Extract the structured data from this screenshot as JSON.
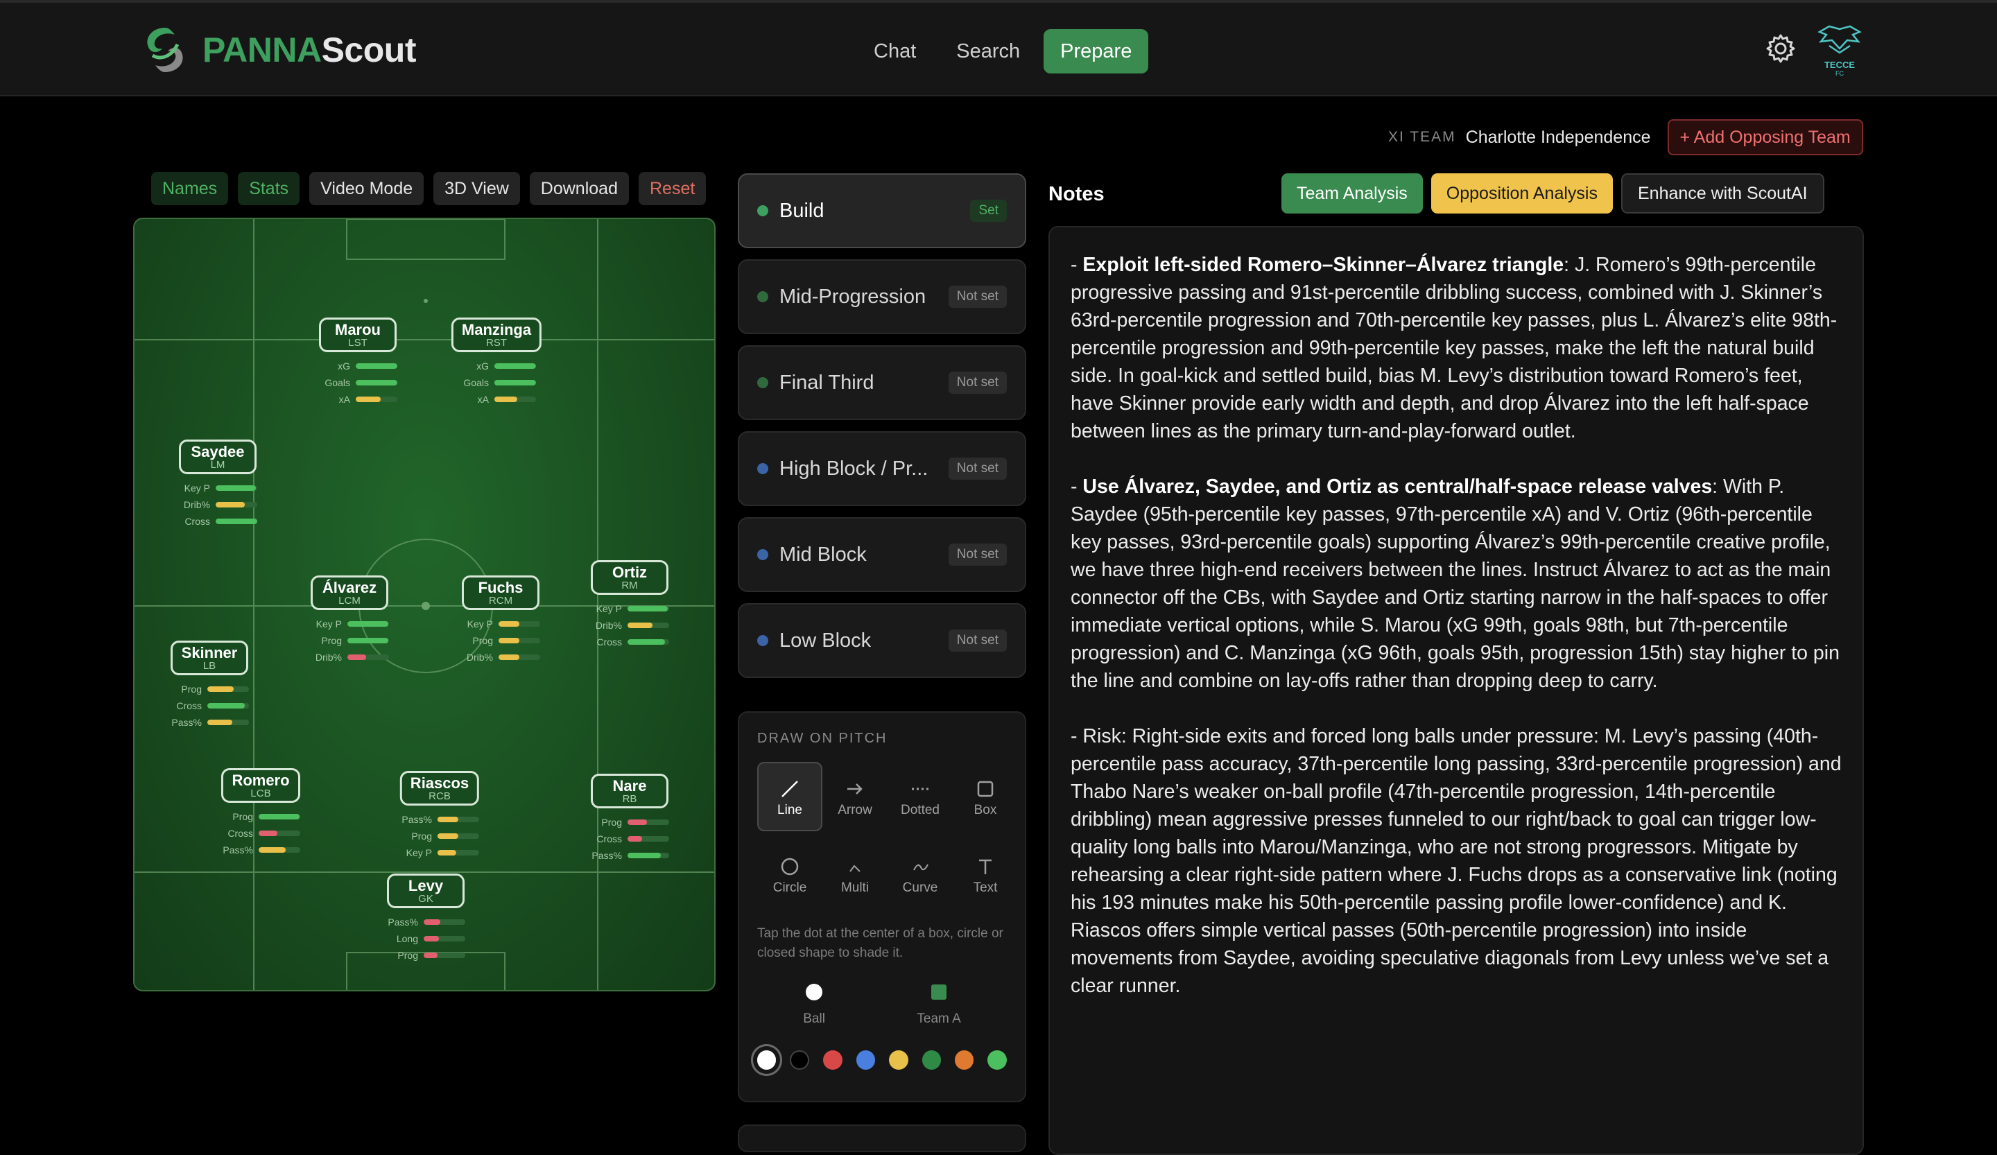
{
  "brand": {
    "prefix": "PANNA",
    "suffix": "Scout"
  },
  "nav": {
    "items": [
      "Chat",
      "Search",
      "Prepare"
    ],
    "active": "Prepare"
  },
  "header": {
    "settings_icon": "gear-icon",
    "crest_text": "TECCE FC"
  },
  "xi": {
    "label": "XI TEAM",
    "team": "Charlotte Independence",
    "add_button": "+ Add Opposing Team"
  },
  "toolbar": {
    "names": "Names",
    "stats": "Stats",
    "video": "Video Mode",
    "view3d": "3D View",
    "download": "Download",
    "reset": "Reset"
  },
  "players": [
    {
      "name": "Marou",
      "role": "LST",
      "stats": [
        {
          "label": "xG",
          "v": 1.0,
          "c": "#4cc05e"
        },
        {
          "label": "Goals",
          "v": 1.0,
          "c": "#4cc05e"
        },
        {
          "label": "xA",
          "v": 0.6,
          "c": "#e8c04a"
        }
      ]
    },
    {
      "name": "Manzinga",
      "role": "RST",
      "stats": [
        {
          "label": "xG",
          "v": 1.0,
          "c": "#4cc05e"
        },
        {
          "label": "Goals",
          "v": 1.0,
          "c": "#4cc05e"
        },
        {
          "label": "xA",
          "v": 0.55,
          "c": "#e8c04a"
        }
      ]
    },
    {
      "name": "Saydee",
      "role": "LM",
      "stats": [
        {
          "label": "Key P",
          "v": 0.97,
          "c": "#4cc05e"
        },
        {
          "label": "Drib%",
          "v": 0.7,
          "c": "#e8c04a"
        },
        {
          "label": "Cross",
          "v": 1.0,
          "c": "#4cc05e"
        }
      ]
    },
    {
      "name": "Álvarez",
      "role": "LCM",
      "stats": [
        {
          "label": "Key P",
          "v": 0.99,
          "c": "#4cc05e"
        },
        {
          "label": "Prog",
          "v": 0.98,
          "c": "#4cc05e"
        },
        {
          "label": "Drib%",
          "v": 0.45,
          "c": "#e06070"
        }
      ]
    },
    {
      "name": "Fuchs",
      "role": "RCM",
      "stats": [
        {
          "label": "Key P",
          "v": 0.5,
          "c": "#e8c04a"
        },
        {
          "label": "Prog",
          "v": 0.5,
          "c": "#e8c04a"
        },
        {
          "label": "Drib%",
          "v": 0.5,
          "c": "#e8c04a"
        }
      ]
    },
    {
      "name": "Ortiz",
      "role": "RM",
      "stats": [
        {
          "label": "Key P",
          "v": 0.96,
          "c": "#4cc05e"
        },
        {
          "label": "Drib%",
          "v": 0.6,
          "c": "#e8c04a"
        },
        {
          "label": "Cross",
          "v": 0.9,
          "c": "#4cc05e"
        }
      ]
    },
    {
      "name": "Skinner",
      "role": "LB",
      "stats": [
        {
          "label": "Prog",
          "v": 0.63,
          "c": "#e8c04a"
        },
        {
          "label": "Cross",
          "v": 0.9,
          "c": "#4cc05e"
        },
        {
          "label": "Pass%",
          "v": 0.6,
          "c": "#e8c04a"
        }
      ]
    },
    {
      "name": "Romero",
      "role": "LCB",
      "stats": [
        {
          "label": "Prog",
          "v": 0.99,
          "c": "#4cc05e"
        },
        {
          "label": "Cross",
          "v": 0.45,
          "c": "#e06070"
        },
        {
          "label": "Pass%",
          "v": 0.65,
          "c": "#e8c04a"
        }
      ]
    },
    {
      "name": "Riascos",
      "role": "RCB",
      "stats": [
        {
          "label": "Pass%",
          "v": 0.5,
          "c": "#e8c04a"
        },
        {
          "label": "Prog",
          "v": 0.5,
          "c": "#e8c04a"
        },
        {
          "label": "Key P",
          "v": 0.45,
          "c": "#e8c04a"
        }
      ]
    },
    {
      "name": "Nare",
      "role": "RB",
      "stats": [
        {
          "label": "Prog",
          "v": 0.47,
          "c": "#e06070"
        },
        {
          "label": "Cross",
          "v": 0.35,
          "c": "#e06070"
        },
        {
          "label": "Pass%",
          "v": 0.8,
          "c": "#4cc05e"
        }
      ]
    },
    {
      "name": "Levy",
      "role": "GK",
      "stats": [
        {
          "label": "Pass%",
          "v": 0.4,
          "c": "#e06070"
        },
        {
          "label": "Long",
          "v": 0.37,
          "c": "#e06070"
        },
        {
          "label": "Prog",
          "v": 0.33,
          "c": "#e06070"
        }
      ]
    }
  ],
  "phases": [
    {
      "title": "Build",
      "status": "Set",
      "dot": "#3ea05e"
    },
    {
      "title": "Mid-Progression",
      "status": "Not set",
      "dot": "#2f6a3c"
    },
    {
      "title": "Final Third",
      "status": "Not set",
      "dot": "#2f6a3c"
    },
    {
      "title": "High Block / Pr...",
      "status": "Not set",
      "dot": "#3a64a6"
    },
    {
      "title": "Mid Block",
      "status": "Not set",
      "dot": "#3a64a6"
    },
    {
      "title": "Low Block",
      "status": "Not set",
      "dot": "#3a64a6"
    }
  ],
  "draw": {
    "heading": "DRAW ON PITCH",
    "tools": [
      {
        "label": "Line",
        "icon": "line-icon"
      },
      {
        "label": "Arrow",
        "icon": "arrow-icon"
      },
      {
        "label": "Dotted",
        "icon": "dotted-icon"
      },
      {
        "label": "Box",
        "icon": "box-icon"
      },
      {
        "label": "Circle",
        "icon": "circle-icon"
      },
      {
        "label": "Multi",
        "icon": "multi-icon"
      },
      {
        "label": "Curve",
        "icon": "curve-icon"
      },
      {
        "label": "Text",
        "icon": "text-icon"
      }
    ],
    "hint": "Tap the dot at the center of a box, circle or closed shape to shade it.",
    "ball": "Ball",
    "team": "Team A",
    "colors": [
      "#ffffff",
      "#000000",
      "#d94848",
      "#4a7fe0",
      "#e8c04a",
      "#2f8a46",
      "#e07a30",
      "#4cc05e"
    ]
  },
  "notes": {
    "heading": "Notes",
    "buttons": {
      "team": "Team Analysis",
      "opp": "Opposition Analysis",
      "enhance": "Enhance with ScoutAI"
    },
    "p1_bold": "Exploit left-sided Romero–Skinner–Álvarez triangle",
    "p1": ": J. Romero’s 99th-percentile progressive passing and 91st-percentile dribbling success, combined with J. Skinner’s 63rd-percentile progression and 70th-percentile key passes, plus L. Álvarez’s elite 98th-percentile progression and 99th-percentile key passes, make the left the natural build side. In goal-kick and settled build, bias M. Levy’s distribution toward Romero’s feet, have Skinner provide early width and depth, and drop Álvarez into the left half-space between lines as the primary turn-and-play-forward outlet.",
    "p2_bold": "Use Álvarez, Saydee, and Ortiz as central/half-space release valves",
    "p2": ": With P. Saydee (95th-percentile key passes, 97th-percentile xA) and V. Ortiz (96th-percentile key passes, 93rd-percentile goals) supporting Álvarez’s 99th-percentile creative profile, we have three high-end receivers between the lines. Instruct Álvarez to act as the main connector off the CBs, with Saydee and Ortiz starting narrow in the half-spaces to offer immediate vertical options, while S. Marou (xG 99th, goals 98th, but 7th-percentile progression) and C. Manzinga (xG 96th, goals 95th, progression 15th) stay higher to pin the line and combine on lay-offs rather than dropping deep to carry.",
    "p3": "- Risk: Right-side exits and forced long balls under pressure: M. Levy’s passing (40th-percentile pass accuracy, 37th-percentile long passing, 33rd-percentile progression) and Thabo Nare’s weaker on-ball profile (47th-percentile progression, 14th-percentile dribbling) mean aggressive presses funneled to our right/back to goal can trigger low-quality long balls into Marou/Manzinga, who are not strong progressors. Mitigate by rehearsing a clear right-side pattern where J. Fuchs drops as a conservative link (noting his 193 minutes make his 50th-percentile passing profile lower-confidence) and K. Riascos offers simple vertical passes (50th-percentile progression) into inside movements from Saydee, avoiding speculative diagonals from Levy unless we’ve set a clear runner."
  }
}
